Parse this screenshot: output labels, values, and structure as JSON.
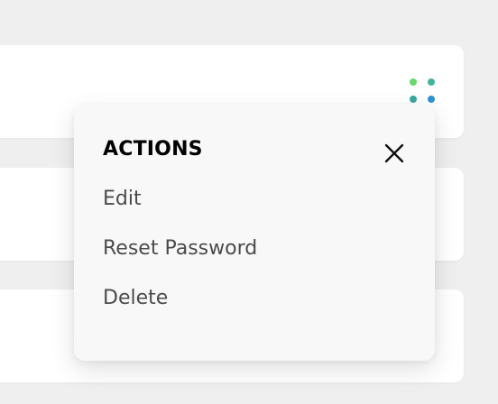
{
  "colors": {
    "page_background": "#efefef",
    "card_background": "#ffffff",
    "menu_background": "#f8f8f8",
    "menu_title": "#000000",
    "menu_item": "#4b4b4b",
    "close_icon": "#111111",
    "dot_colors": [
      "#67d86a",
      "#44b59a",
      "#3aa8a0",
      "#2f93d8"
    ]
  },
  "icons": {
    "dots": "dots-grid-icon",
    "close": "close-icon"
  },
  "actions_menu": {
    "title": "ACTIONS",
    "items": [
      {
        "label": "Edit"
      },
      {
        "label": "Reset Password"
      },
      {
        "label": "Delete"
      }
    ]
  }
}
